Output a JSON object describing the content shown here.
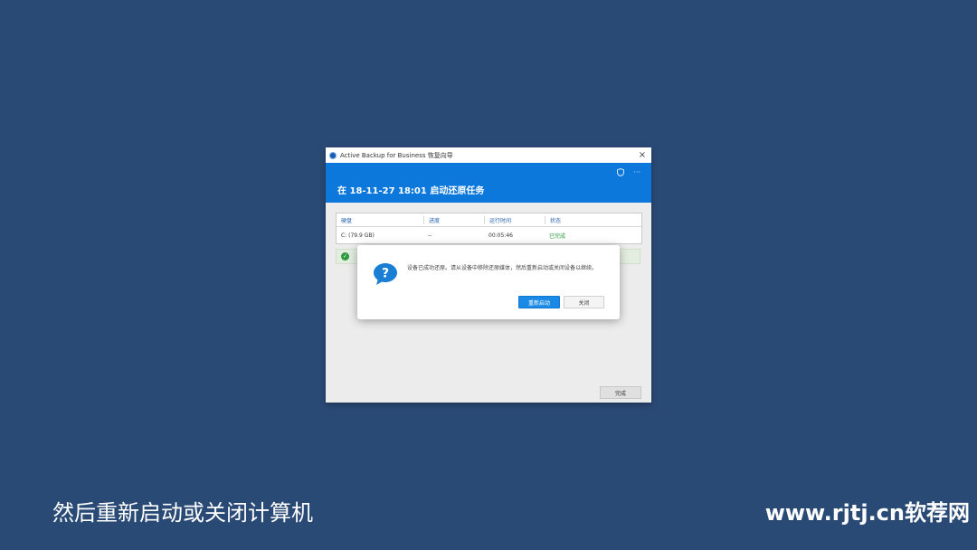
{
  "window": {
    "title": "Active Backup for Business 恢复向导",
    "close_glyph": "×",
    "header_icons": [
      "shield-icon",
      "more-icon"
    ],
    "more_glyph": "···",
    "heading": "在 18-11-27 18:01 启动还原任务"
  },
  "table": {
    "columns": [
      "硬盘",
      "进度",
      "运行时间",
      "状态"
    ],
    "rows": [
      {
        "disk": "C: (79.9 GB)",
        "progress": "--",
        "runtime": "00:05:46",
        "status": "已完成"
      }
    ]
  },
  "success_bar": {
    "icon": "check-circle-icon"
  },
  "done_button": "完成",
  "dialog": {
    "icon": "question-bubble-icon",
    "message": "设备已成功还原。请从设备中移除还原媒体，然后重新启动或关闭设备以继续。",
    "restart_label": "重新启动",
    "close_label": "关闭"
  },
  "caption": "然后重新启动或关闭计算机",
  "watermark": "www.rjtj.cn软荐网",
  "colors": {
    "background": "#2a4a76",
    "header_blue": "#0c78dc",
    "primary_button": "#1a8ae6",
    "success_green": "#2e9a3e"
  }
}
